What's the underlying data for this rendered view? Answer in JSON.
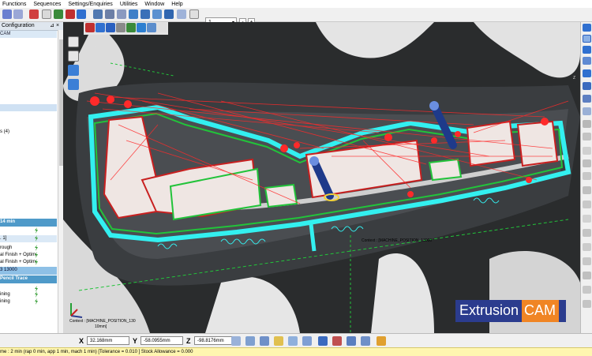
{
  "menu": [
    "Functions",
    "Sequences",
    "Settings/Enquiries",
    "Utilities",
    "Window",
    "Help"
  ],
  "toolbar": {
    "view_select": "1",
    "minus": "-",
    "plus": "+"
  },
  "panel": {
    "header": "Configuration",
    "item_cam": "CAM",
    "item_four": "s (4)",
    "time_band": "14 min",
    "item_bracket": ". 1]",
    "item_through": "rough",
    "item_finish1": "al Finish + Optim.",
    "item_finish2": "al Finish + Optim.",
    "item_pos": "3 13000",
    "item_pencil": "Pencil Trace",
    "item_machining1": "ining",
    "item_machining2": "ining"
  },
  "viewport": {
    "context_center": "Context : [MACHINE_POSITION_13000",
    "context_corner": "Context : [MACHINE_POSITION_130",
    "context_corner_unit": "10mm]",
    "axis_y": "Y",
    "axis_x": "X",
    "axis_z": "Z",
    "logo_part1": "Extrusion",
    "logo_part2": "CAM"
  },
  "coords": {
    "x_label": "X",
    "x_value": "32.168mm",
    "y_label": "Y",
    "y_value": "-58.0955mm",
    "z_label": "Z",
    "z_value": "-98.8176mm"
  },
  "status": "me : 2 min (rap 0 min, app 1 min, mach 1 min) [Tolerance = 0.010 ] Stock Allowance = 0.000",
  "colors": {
    "toolpath_red": "#ff2a2a",
    "toolpath_cyan": "#33f0f0",
    "toolpath_green": "#22c33a",
    "tool_blue": "#1e3a8a",
    "logo_blue": "#2b3c8e",
    "logo_orange": "#f08524",
    "panel_band": "#4f9ac9",
    "status_bg": "#fff6b0"
  }
}
